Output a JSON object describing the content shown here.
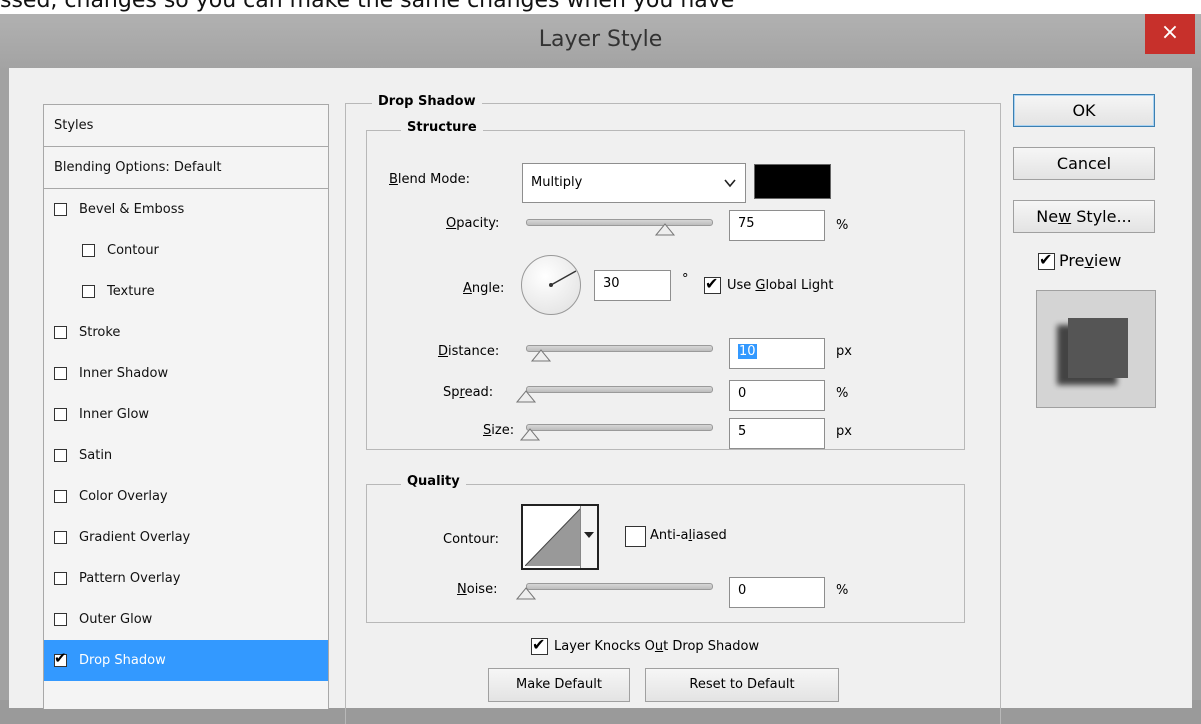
{
  "top_strip_text": "ssed, changes so you can make the same changes when you have",
  "window": {
    "title": "Layer Style",
    "close_glyph": "×"
  },
  "sidebar": {
    "header": "Styles",
    "blending": "Blending Options: Default",
    "items": [
      {
        "label": "Bevel & Emboss",
        "checked": false
      },
      {
        "label": "Contour",
        "checked": false
      },
      {
        "label": "Texture",
        "checked": false
      },
      {
        "label": "Stroke",
        "checked": false
      },
      {
        "label": "Inner Shadow",
        "checked": false
      },
      {
        "label": "Inner Glow",
        "checked": false
      },
      {
        "label": "Satin",
        "checked": false
      },
      {
        "label": "Color Overlay",
        "checked": false
      },
      {
        "label": "Gradient Overlay",
        "checked": false
      },
      {
        "label": "Pattern Overlay",
        "checked": false
      },
      {
        "label": "Outer Glow",
        "checked": false
      },
      {
        "label": "Drop Shadow",
        "checked": true,
        "selected": true
      }
    ]
  },
  "drop_shadow": {
    "group_title": "Drop Shadow",
    "structure": {
      "title": "Structure",
      "blend_mode_label": "Blend Mode:",
      "blend_mode_value": "Multiply",
      "shadow_color": "#000000",
      "opacity_label": "Opacity:",
      "opacity_value": "75",
      "opacity_unit": "%",
      "opacity_level": 0.75,
      "angle_label": "Angle:",
      "angle_value": "30",
      "angle_unit": "°",
      "use_global_light_label": "Use Global Light",
      "use_global_light_checked": true,
      "distance_label": "Distance:",
      "distance_value": "10",
      "distance_unit": "px",
      "distance_level": 0.08,
      "spread_label": "Spread:",
      "spread_value": "0",
      "spread_unit": "%",
      "spread_level": 0,
      "size_label": "Size:",
      "size_value": "5",
      "size_unit": "px",
      "size_level": 0.02
    },
    "quality": {
      "title": "Quality",
      "contour_label": "Contour:",
      "anti_aliased_label": "Anti-aliased",
      "anti_aliased_checked": false,
      "noise_label": "Noise:",
      "noise_value": "0",
      "noise_unit": "%",
      "noise_level": 0
    },
    "knocks_out_label": "Layer Knocks Out Drop Shadow",
    "knocks_out_checked": true,
    "make_default_label": "Make Default",
    "reset_default_label": "Reset to Default"
  },
  "buttons": {
    "ok": "OK",
    "cancel": "Cancel",
    "new_style": "New Style...",
    "preview_label": "Preview",
    "preview_checked": true
  }
}
